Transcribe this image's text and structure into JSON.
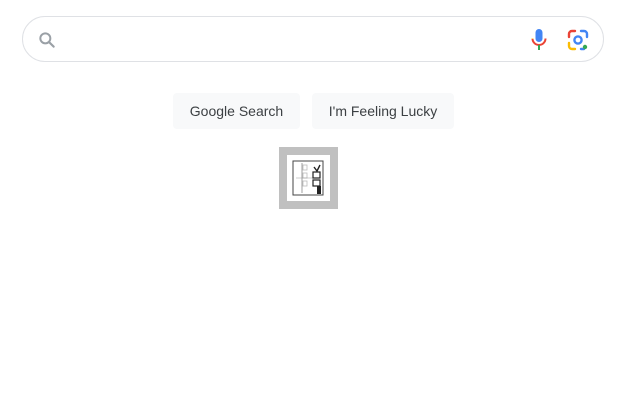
{
  "search": {
    "value": "",
    "placeholder": ""
  },
  "buttons": {
    "search_label": "Google Search",
    "lucky_label": "I'm Feeling Lucky"
  },
  "icons": {
    "search": "search-icon",
    "mic": "mic-icon",
    "lens": "camera-lens-icon",
    "broken_image": "broken-image-icon"
  },
  "colors": {
    "border": "#dfe1e5",
    "button_bg": "#f8f9fa",
    "button_text": "#3c4043",
    "mic_blue": "#4285f4",
    "mic_red": "#ea4335",
    "lens_green": "#34a853",
    "lens_yellow": "#fbbc04"
  }
}
